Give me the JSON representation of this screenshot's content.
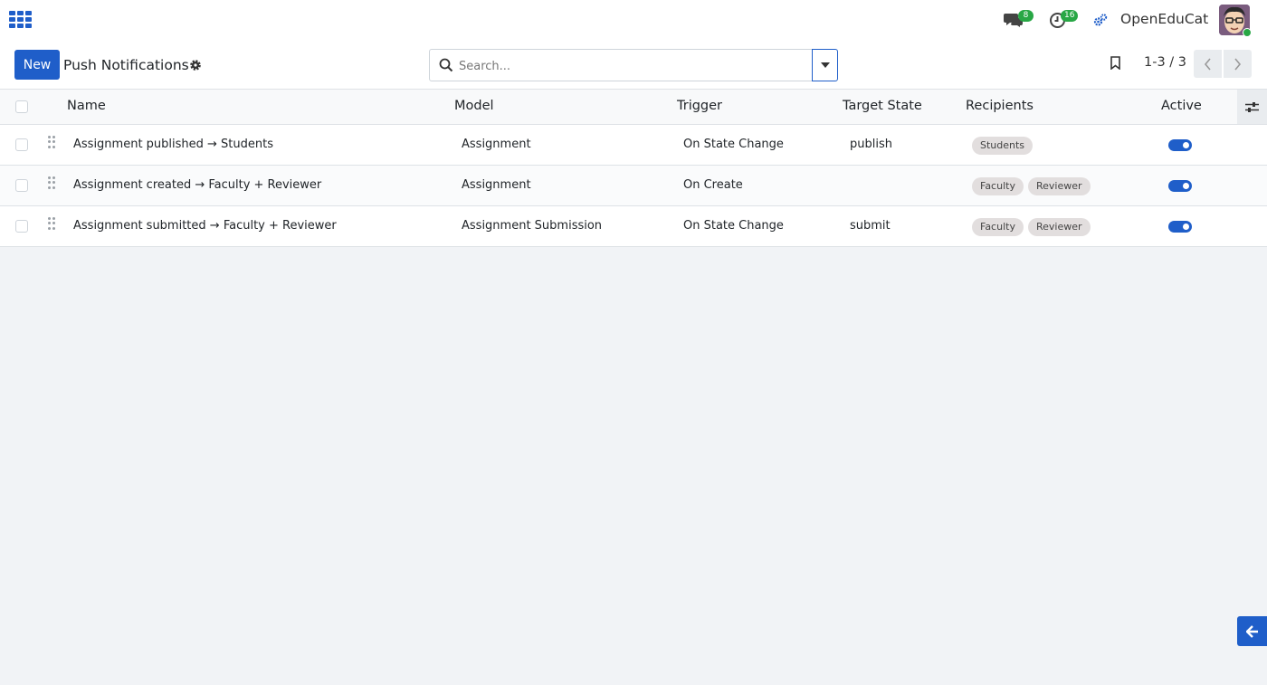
{
  "navbar": {
    "messages_badge": "8",
    "activities_badge": "16",
    "company_name": "OpenEduCat"
  },
  "control_panel": {
    "new_label": "New",
    "title": "Push Notifications",
    "search_placeholder": "Search...",
    "pager": "1-3 / 3"
  },
  "table": {
    "columns": {
      "name": "Name",
      "model": "Model",
      "trigger": "Trigger",
      "target_state": "Target State",
      "recipients": "Recipients",
      "active": "Active"
    },
    "rows": [
      {
        "name": "Assignment published → Students",
        "model": "Assignment",
        "trigger": "On State Change",
        "target_state": "publish",
        "recipients": [
          "Students"
        ],
        "active": true
      },
      {
        "name": "Assignment created → Faculty + Reviewer",
        "model": "Assignment",
        "trigger": "On Create",
        "target_state": "",
        "recipients": [
          "Faculty",
          "Reviewer"
        ],
        "active": true
      },
      {
        "name": "Assignment submitted → Faculty + Reviewer",
        "model": "Assignment Submission",
        "trigger": "On State Change",
        "target_state": "submit",
        "recipients": [
          "Faculty",
          "Reviewer"
        ],
        "active": true
      }
    ]
  },
  "colors": {
    "primary": "#1f5ec9",
    "badge": "#28a745",
    "tag_bg": "#e2dede"
  }
}
